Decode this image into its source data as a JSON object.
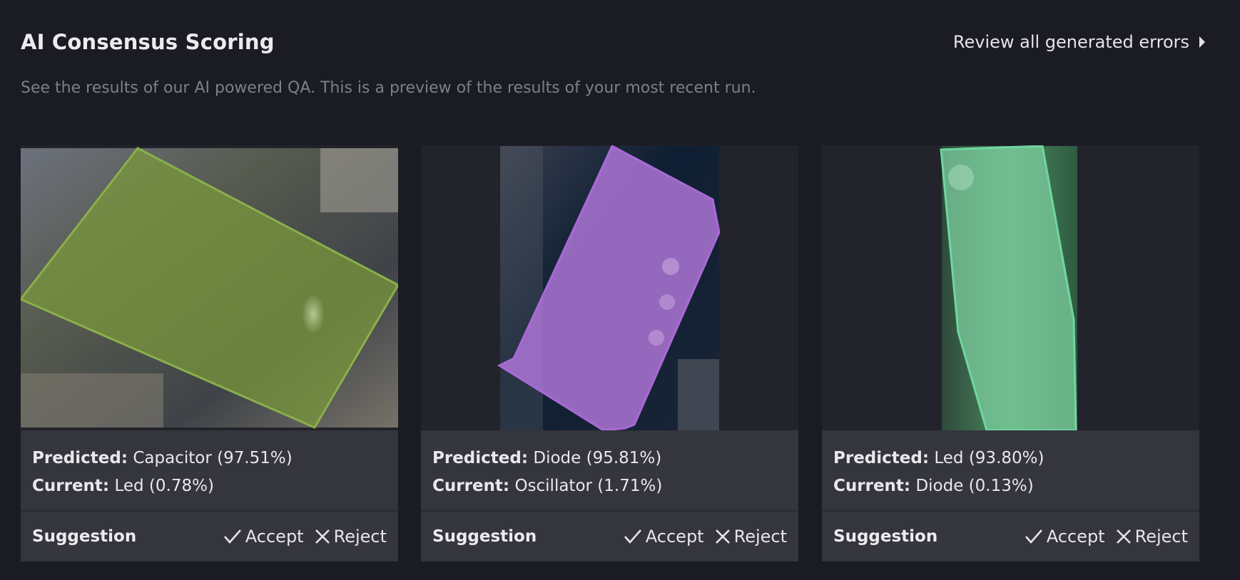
{
  "header": {
    "title": "AI Consensus Scoring",
    "review_link": "Review all generated errors",
    "subtitle": "See the results of our AI powered QA. This is a preview of the results of your most recent run."
  },
  "cards": [
    {
      "predicted_label": "Predicted",
      "predicted_value": "Capacitor (97.51%)",
      "current_label": "Current",
      "current_value": "Led (0.78%)",
      "suggestion_label": "Suggestion",
      "accept_label": "Accept",
      "reject_label": "Reject",
      "annotation_color": "#8ab04a"
    },
    {
      "predicted_label": "Predicted",
      "predicted_value": "Diode (95.81%)",
      "current_label": "Current",
      "current_value": "Oscillator (1.71%)",
      "suggestion_label": "Suggestion",
      "accept_label": "Accept",
      "reject_label": "Reject",
      "annotation_color": "#a86ad6"
    },
    {
      "predicted_label": "Predicted",
      "predicted_value": "Led (93.80%)",
      "current_label": "Current",
      "current_value": "Diode (0.13%)",
      "suggestion_label": "Suggestion",
      "accept_label": "Accept",
      "reject_label": "Reject",
      "annotation_color": "#6fd6a0"
    }
  ],
  "icons": {
    "accept": "check-icon",
    "reject": "x-icon",
    "review": "caret-right-icon"
  }
}
